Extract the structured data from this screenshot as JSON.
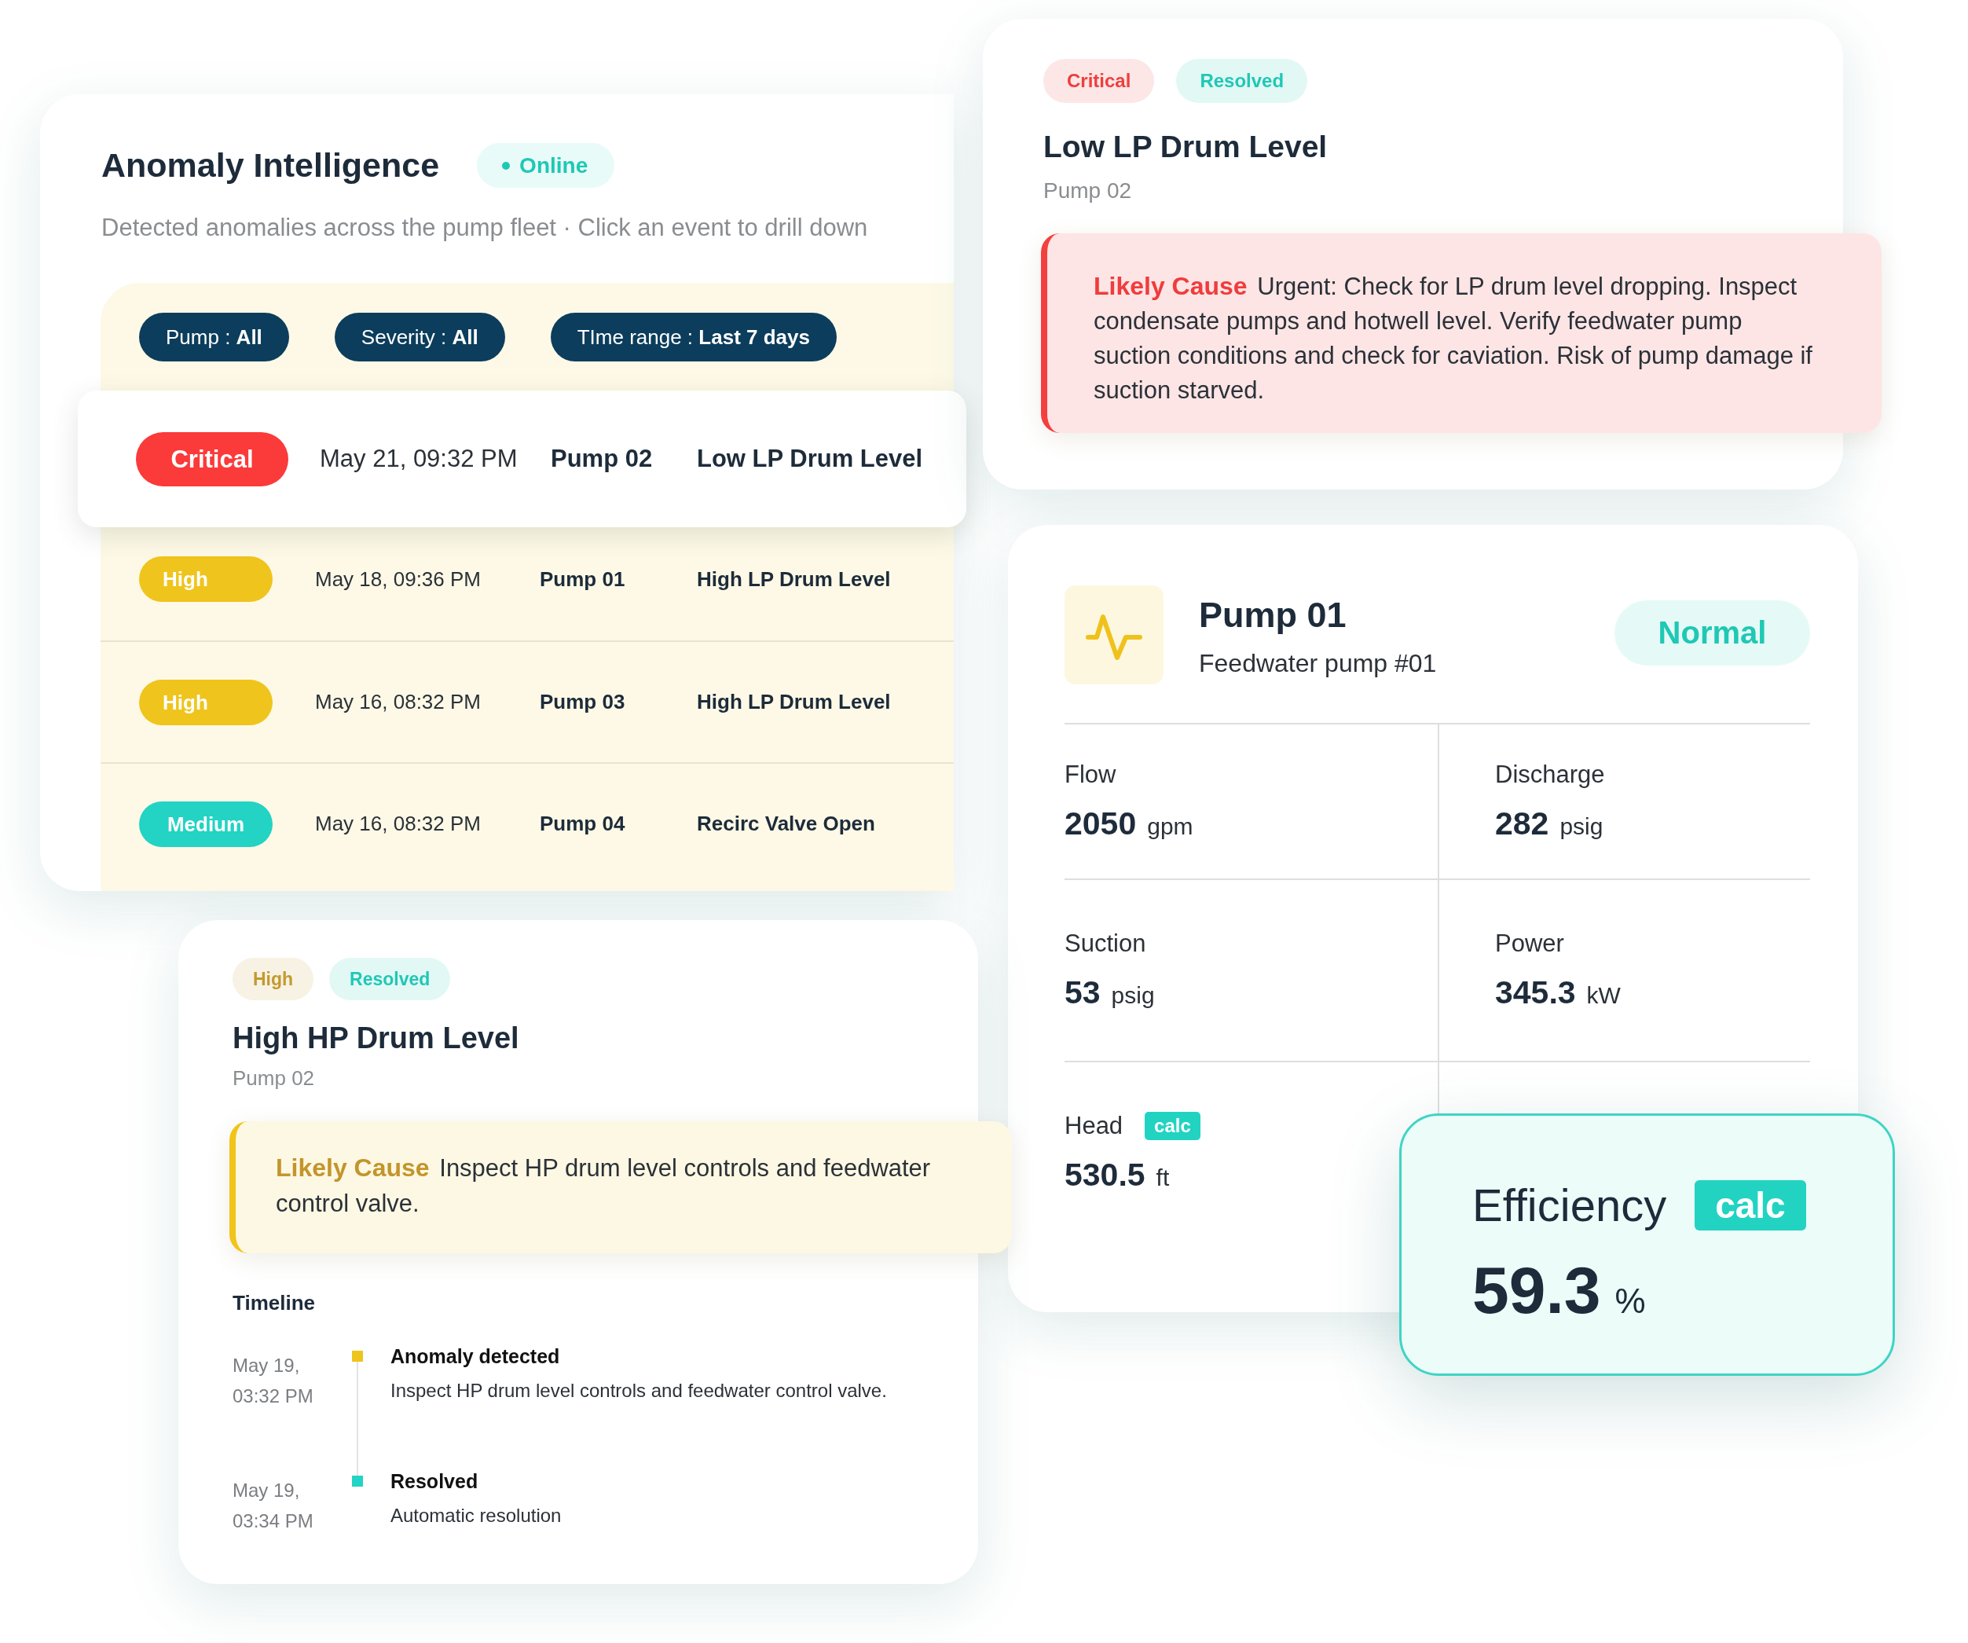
{
  "anomaly_panel": {
    "title": "Anomaly Intelligence",
    "status": "Online",
    "subtitle": "Detected anomalies across the pump fleet · Click an event to drill down",
    "filters": [
      {
        "label": "Pump :",
        "value": "All"
      },
      {
        "label": "Severity :",
        "value": "All"
      },
      {
        "label": "TIme range :",
        "value": "Last 7 days"
      }
    ],
    "events": [
      {
        "severity": "Critical",
        "color": "#fb3a3a",
        "time": "May 21, 09:32 PM",
        "pump": "Pump 02",
        "event": "Low LP Drum Level",
        "selected": true
      },
      {
        "severity": "High",
        "color": "#efc41c",
        "time": "May 18, 09:36 PM",
        "pump": "Pump 01",
        "event": "High LP Drum Level",
        "selected": false
      },
      {
        "severity": "High",
        "color": "#efc41c",
        "time": "May 16, 08:32 PM",
        "pump": "Pump 03",
        "event": "High LP Drum Level",
        "selected": false
      },
      {
        "severity": "Medium",
        "color": "#23d3c3",
        "time": "May 16, 08:32 PM",
        "pump": "Pump 04",
        "event": "Recirc Valve Open",
        "selected": false
      }
    ]
  },
  "incidents": [
    {
      "tags": [
        {
          "label": "Critical",
          "color": "#ef3e3e"
        },
        {
          "label": "Resolved",
          "color": "#1fc8b5"
        }
      ],
      "title": "Low LP Drum Level",
      "subtitle": "Pump 02",
      "cause": {
        "kind": "critical",
        "text": "**Likely Cause** Urgent: Check for LP drum level dropping. Inspect condensate pumps and hotwell level. Verify feedwater pump suction conditions and check for caviation. Risk of pump damage if suction starved."
      }
    },
    {
      "tags": [
        {
          "label": "High",
          "color": "#c29a2e"
        },
        {
          "label": "Resolved",
          "color": "#1fc8b5"
        }
      ],
      "title": "High HP Drum Level",
      "subtitle": "Pump 02",
      "cause": {
        "kind": "high",
        "text": "**Likely Cause** Inspect HP drum level controls and feedwater control valve."
      },
      "timeline": {
        "title": "Timeline",
        "entries": [
          {
            "time": "May 19, 03:32 PM",
            "title": "Anomaly detected",
            "detail": "Inspect HP drum level controls and feedwater control valve.",
            "color": "#efc41c"
          },
          {
            "time": "May 19, 03:34 PM",
            "title": "Resolved",
            "detail": "Automatic resolution",
            "color": "#23d3c3"
          }
        ]
      }
    }
  ],
  "pump": {
    "name": "Pump 01",
    "description": "Feedwater pump #01",
    "status": "Normal",
    "metrics": [
      {
        "label": "Flow",
        "value": "2050",
        "unit": "gpm"
      },
      {
        "label": "Discharge",
        "value": "282",
        "unit": "psig"
      },
      {
        "label": "Suction",
        "value": "53",
        "unit": "psig"
      },
      {
        "label": "Power",
        "value": "345.3",
        "unit": "kW"
      },
      {
        "label": "Head",
        "tag": "calc",
        "value": "530.5",
        "unit": "ft"
      }
    ]
  },
  "efficiency": {
    "label": "Efficiency",
    "tag": "calc",
    "value": "59.3",
    "unit": "%"
  }
}
